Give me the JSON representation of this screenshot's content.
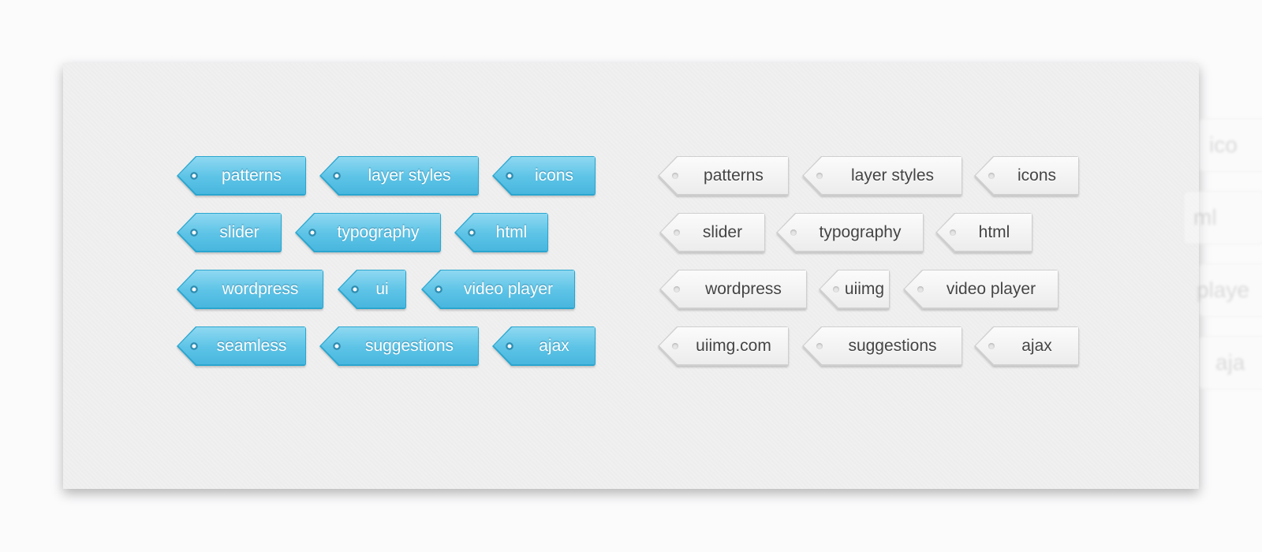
{
  "blue_tags": [
    {
      "label": "patterns"
    },
    {
      "label": "layer styles"
    },
    {
      "label": "icons"
    },
    {
      "label": "slider"
    },
    {
      "label": "typography"
    },
    {
      "label": "html"
    },
    {
      "label": "wordpress"
    },
    {
      "label": "ui"
    },
    {
      "label": "video player"
    },
    {
      "label": "seamless"
    },
    {
      "label": "suggestions"
    },
    {
      "label": "ajax"
    }
  ],
  "gray_tags": [
    {
      "label": "patterns"
    },
    {
      "label": "layer styles"
    },
    {
      "label": "icons"
    },
    {
      "label": "slider"
    },
    {
      "label": "typography"
    },
    {
      "label": "html"
    },
    {
      "label": "wordpress"
    },
    {
      "label": "uiimg"
    },
    {
      "label": "video player"
    },
    {
      "label": "uiimg.com"
    },
    {
      "label": "suggestions"
    },
    {
      "label": "ajax"
    }
  ],
  "background_tags": [
    {
      "label": "ico"
    },
    {
      "label": "ml"
    },
    {
      "label": "playe"
    },
    {
      "label": "aja"
    }
  ],
  "colors": {
    "blue": "#5cc3e6",
    "gray": "#eeeeee"
  }
}
